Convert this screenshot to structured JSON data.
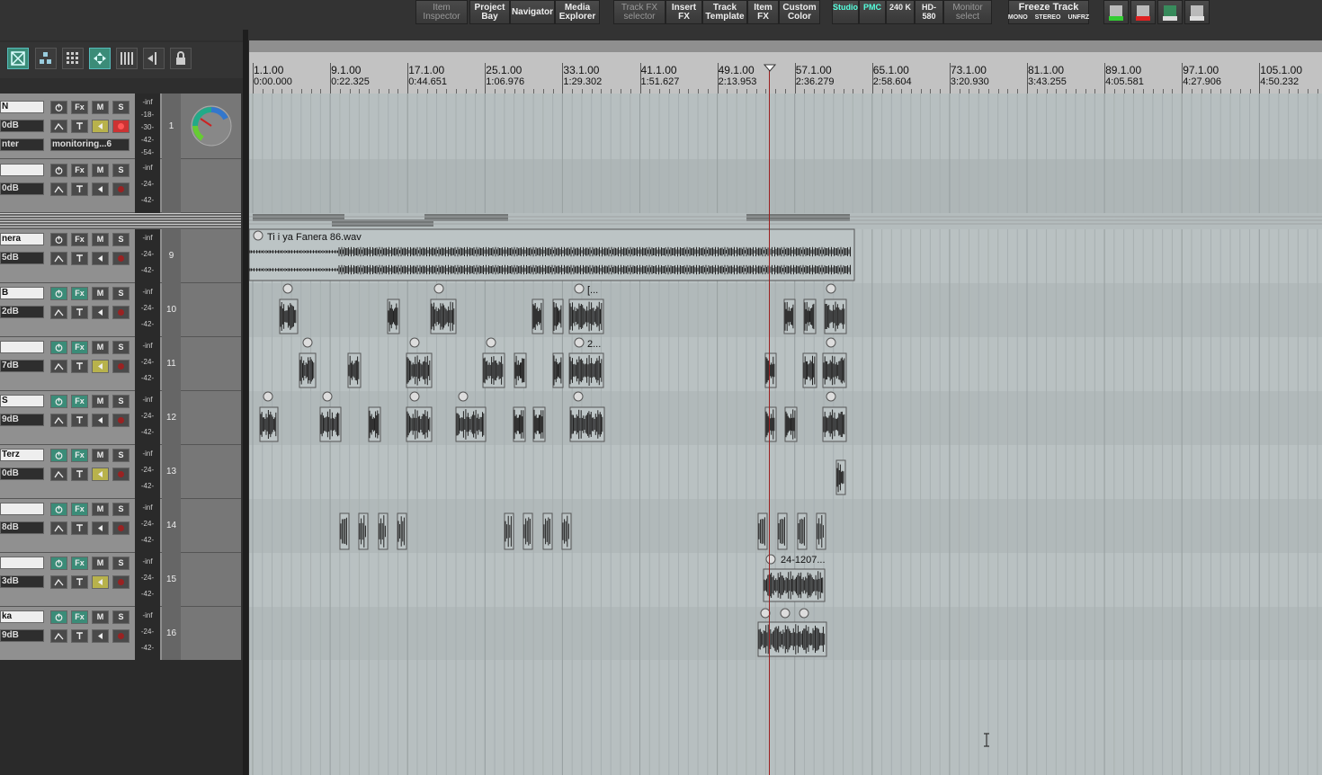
{
  "toolbar": {
    "buttons": [
      {
        "label": "Item\nInspector",
        "style": "dim"
      },
      {
        "label": "Project\nBay",
        "style": ""
      },
      {
        "label": "Navigator",
        "style": ""
      },
      {
        "label": "Media\nExplorer",
        "style": ""
      },
      {
        "label": "Track FX\nselector",
        "style": "dim"
      },
      {
        "label": "Insert\nFX",
        "style": ""
      },
      {
        "label": "Track\nTemplate",
        "style": ""
      },
      {
        "label": "Item\nFX",
        "style": ""
      },
      {
        "label": "Custom\nColor",
        "style": ""
      },
      {
        "label": "Studio",
        "style": "green"
      },
      {
        "label": "PMC",
        "style": "green"
      },
      {
        "label": "240 K",
        "style": ""
      },
      {
        "label": "HD-580",
        "style": ""
      },
      {
        "label": "Monitor\nselect",
        "style": "dim"
      }
    ],
    "freeze": {
      "title": "Freeze Track",
      "mono": "MONO",
      "stereo": "STEREO",
      "unfrz": "UNFRZ"
    }
  },
  "ruler": {
    "marks": [
      {
        "bar": "1.1.00",
        "time": "0:00.000"
      },
      {
        "bar": "9.1.00",
        "time": "0:22.325"
      },
      {
        "bar": "17.1.00",
        "time": "0:44.651"
      },
      {
        "bar": "25.1.00",
        "time": "1:06.976"
      },
      {
        "bar": "33.1.00",
        "time": "1:29.302"
      },
      {
        "bar": "41.1.00",
        "time": "1:51.627"
      },
      {
        "bar": "49.1.00",
        "time": "2:13.953"
      },
      {
        "bar": "57.1.00",
        "time": "2:36.279"
      },
      {
        "bar": "65.1.00",
        "time": "2:58.604"
      },
      {
        "bar": "73.1.00",
        "time": "3:20.930"
      },
      {
        "bar": "81.1.00",
        "time": "3:43.255"
      },
      {
        "bar": "89.1.00",
        "time": "4:05.581"
      },
      {
        "bar": "97.1.00",
        "time": "4:27.906"
      },
      {
        "bar": "105.1.00",
        "time": "4:50.232"
      }
    ]
  },
  "tracks": [
    {
      "num": "1",
      "name": "N",
      "vol": "0dB",
      "extra": "nter",
      "monitor": "monitoring...6"
    },
    {
      "num": "",
      "name": "",
      "vol": "0dB"
    },
    {
      "num": "9",
      "name": "nera",
      "vol": "5dB"
    },
    {
      "num": "10",
      "name": "B",
      "vol": "2dB"
    },
    {
      "num": "11",
      "name": "",
      "vol": "7dB"
    },
    {
      "num": "12",
      "name": "S",
      "vol": "9dB"
    },
    {
      "num": "13",
      "name": "Terz",
      "vol": "0dB"
    },
    {
      "num": "14",
      "name": "",
      "vol": "8dB"
    },
    {
      "num": "15",
      "name": "",
      "vol": "3dB"
    },
    {
      "num": "16",
      "name": "ka",
      "vol": "9dB"
    }
  ],
  "track_buttons": {
    "fx": "Fx",
    "mute": "M",
    "solo": "S"
  },
  "meter": {
    "inf": "-inf",
    "m18": "-18-",
    "m30": "-30-",
    "m42": "-42-",
    "m54": "-54-",
    "m24": "-24-"
  },
  "items": {
    "long_item": "Ti i ya Fanera 86.wav",
    "t10_label": "[...",
    "t11_label": "2...",
    "t15_label": "24-1207..."
  }
}
